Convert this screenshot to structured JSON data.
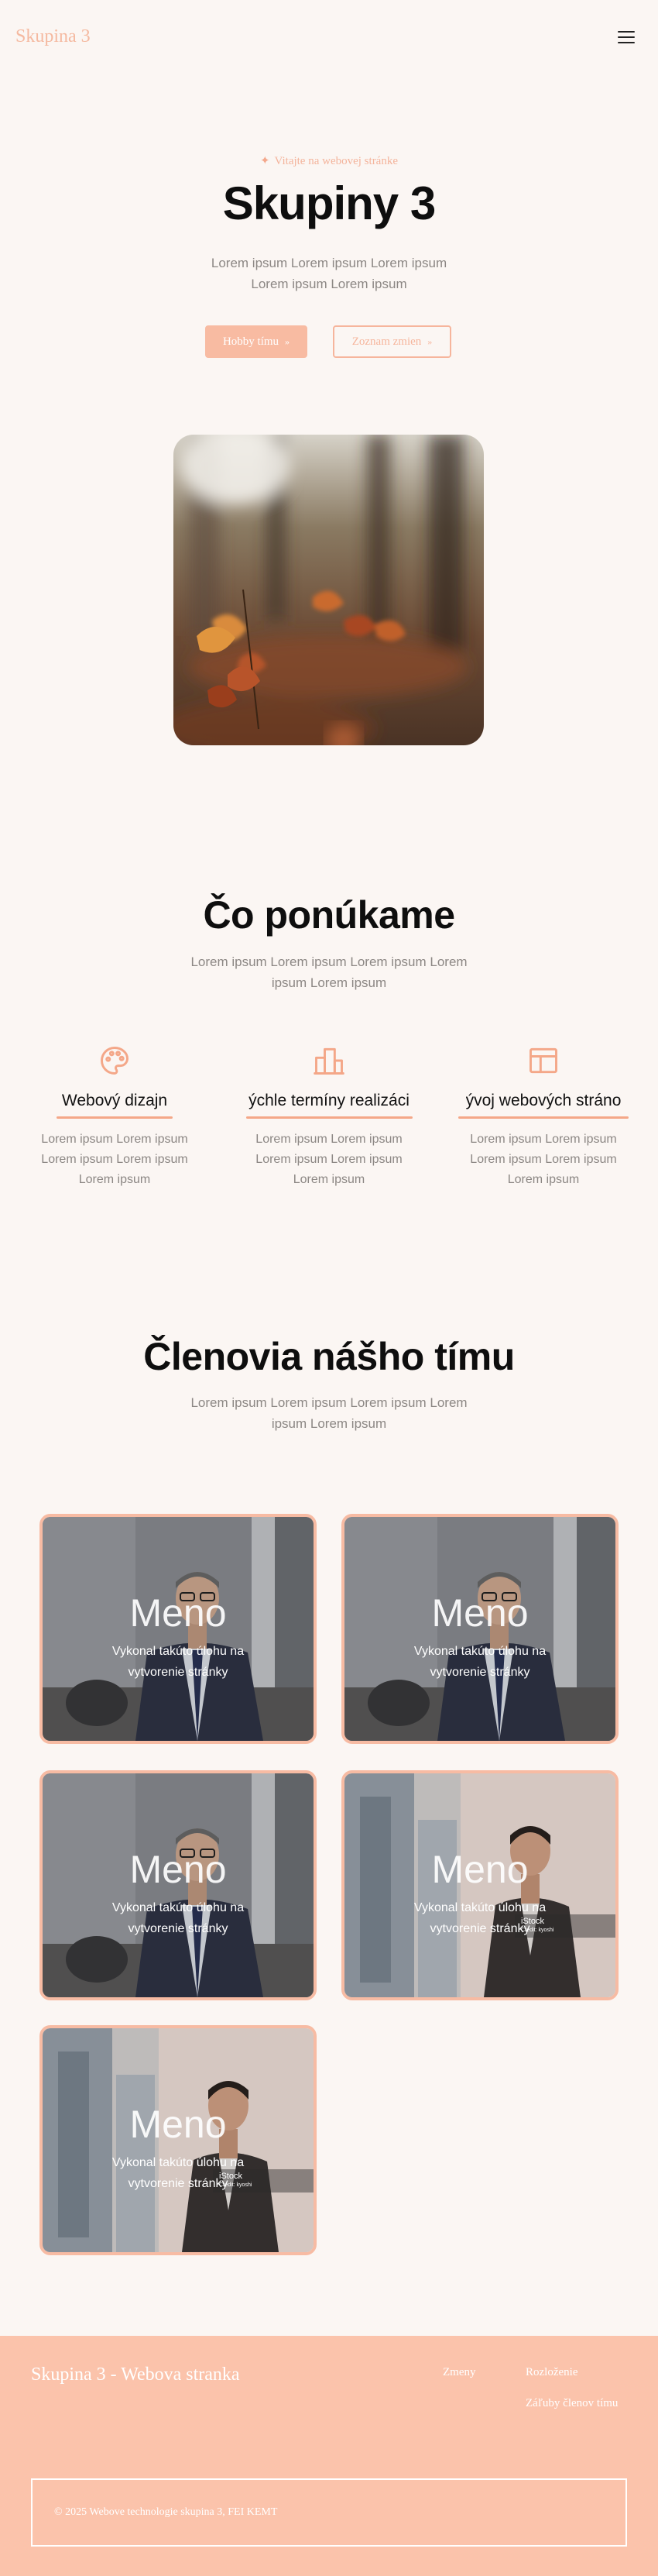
{
  "header": {
    "logo": "Skupina 3",
    "menu_icon": "hamburger-menu-icon"
  },
  "hero": {
    "welcome": "Vitajte na webovej stránke",
    "welcome_icon": "sparkle-icon",
    "title": "Skupiny 3",
    "subtitle": "Lorem ipsum Lorem ipsum Lorem ipsum Lorem ipsum Lorem ipsum",
    "primary_button": "Hobby tímu",
    "secondary_button": "Zoznam zmien",
    "button_arrow": "»"
  },
  "offer": {
    "title": "Čo ponúkame",
    "subtitle": "Lorem ipsum Lorem ipsum Lorem ipsum Lorem ipsum Lorem ipsum",
    "services": [
      {
        "icon": "palette-icon",
        "title": "Webový dizajn",
        "desc": "Lorem ipsum Lorem ipsum Lorem ipsum Lorem ipsum Lorem ipsum"
      },
      {
        "icon": "buildings-icon",
        "title": "ýchle termíny realizáci",
        "desc": "Lorem ipsum Lorem ipsum Lorem ipsum Lorem ipsum Lorem ipsum"
      },
      {
        "icon": "layout-icon",
        "title": "ývoj webových stráno",
        "desc": "Lorem ipsum Lorem ipsum Lorem ipsum Lorem ipsum Lorem ipsum"
      }
    ]
  },
  "team": {
    "title": "Členovia nášho tímu",
    "subtitle": "Lorem ipsum Lorem ipsum Lorem ipsum Lorem ipsum Lorem ipsum",
    "members": [
      {
        "name": "Meno",
        "desc": "Vykonal takúto úlohu na vytvorenie stránky"
      },
      {
        "name": "Meno",
        "desc": "Vykonal takúto úlohu na vytvorenie stránky"
      },
      {
        "name": "Meno",
        "desc": "Vykonal takúto úlohu na vytvorenie stránky"
      },
      {
        "name": "Meno",
        "desc": "Vykonal takúto úlohu na vytvorenie stránky",
        "watermark": "iStock",
        "watermark_sub": "Credit: kyoshi"
      },
      {
        "name": "Meno",
        "desc": "Vykonal takúto úlohu na vytvorenie stránky",
        "watermark": "iStock",
        "watermark_sub": "Credit: kyoshi"
      }
    ]
  },
  "footer": {
    "title": "Skupina 3 - Webova stranka",
    "links": [
      "Zmeny",
      "Rozloženie",
      "Záľuby členov tímu"
    ],
    "copyright": "© 2025 Webove technologie skupina 3, FEI KEMT"
  },
  "colors": {
    "accent": "#f8bba2",
    "footer_bg": "#fbc3ab",
    "background": "#fbf6f3",
    "muted_text": "#8c8784"
  }
}
